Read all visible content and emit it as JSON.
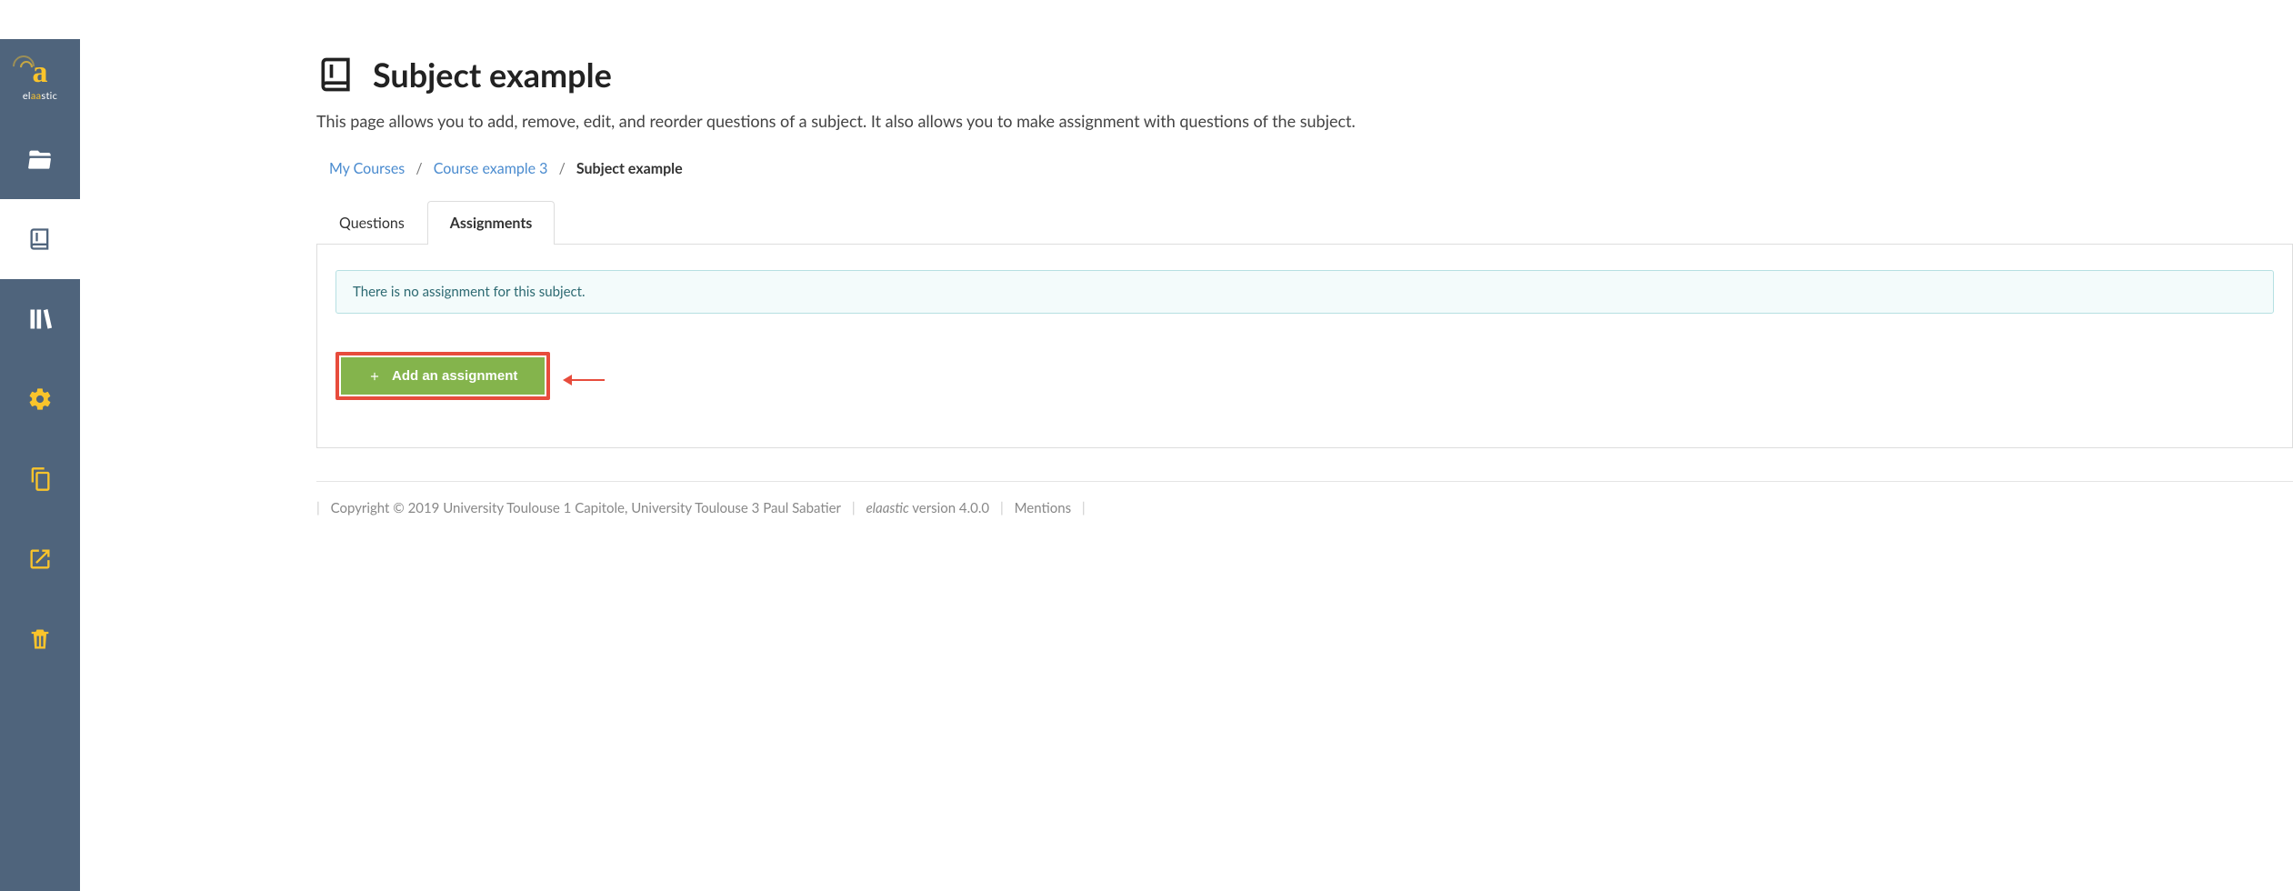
{
  "brand": {
    "name_pre": "el",
    "name_accent": "aa",
    "name_post": "stic"
  },
  "header": {
    "title": "Subject example",
    "subtitle": "This page allows you to add, remove, edit, and reorder questions of a subject. It also allows you to make assignment with questions of the subject."
  },
  "breadcrumb": {
    "items": [
      {
        "label": "My Courses"
      },
      {
        "label": "Course example 3"
      }
    ],
    "current": "Subject example"
  },
  "tabs": {
    "questions": {
      "label": "Questions"
    },
    "assignments": {
      "label": "Assignments"
    }
  },
  "panel": {
    "empty_message": "There is no assignment for this subject.",
    "add_button": "Add an assignment"
  },
  "footer": {
    "copyright": "Copyright © 2019 University Toulouse 1 Capitole, University Toulouse 3 Paul Sabatier",
    "version_app": "elaastic",
    "version_text": " version 4.0.0",
    "mentions": "Mentions"
  }
}
